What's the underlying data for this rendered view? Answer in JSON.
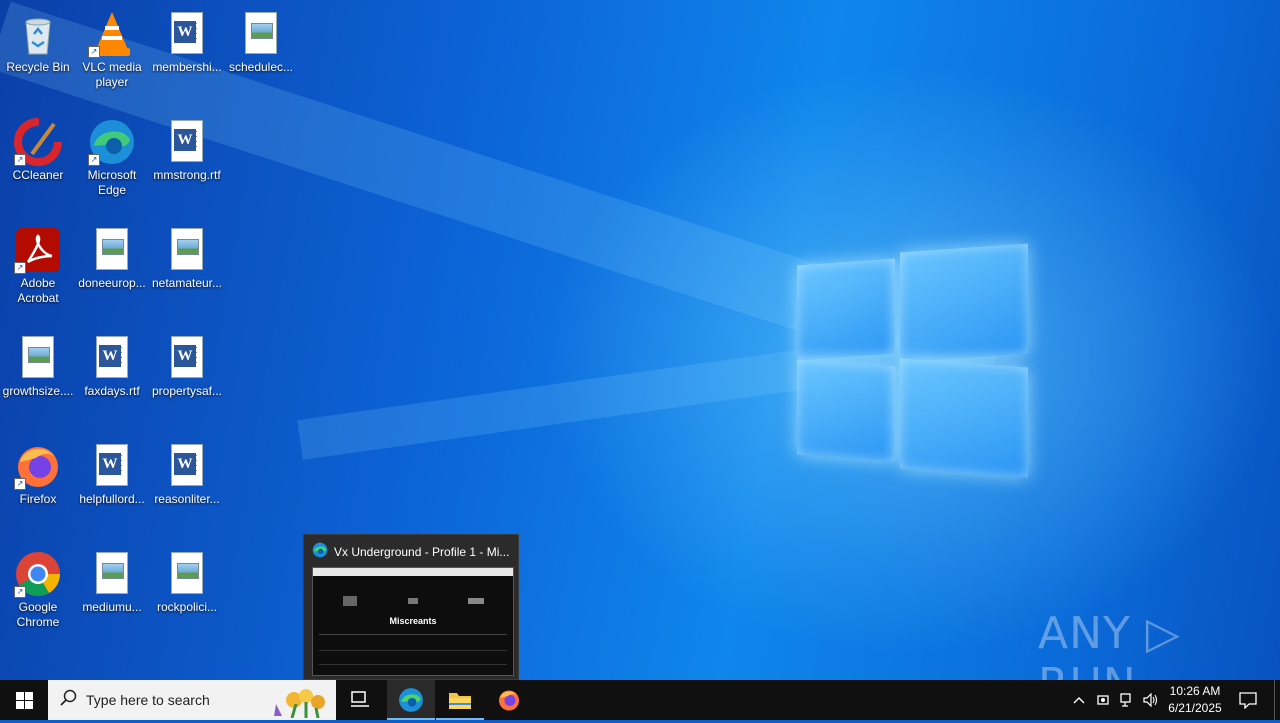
{
  "desktop": {
    "icons": [
      {
        "label": "Recycle Bin",
        "icon": "recycle-bin-icon"
      },
      {
        "label": "VLC media player",
        "icon": "vlc-icon"
      },
      {
        "label": "membershi...",
        "icon": "word-doc-icon"
      },
      {
        "label": "schedulec...",
        "icon": "image-doc-icon"
      },
      {
        "label": "CCleaner",
        "icon": "ccleaner-icon"
      },
      {
        "label": "Microsoft Edge",
        "icon": "edge-icon"
      },
      {
        "label": "mmstrong.rtf",
        "icon": "word-doc-icon"
      },
      {
        "label": "Adobe Acrobat",
        "icon": "acrobat-icon"
      },
      {
        "label": "doneeurop...",
        "icon": "image-doc-icon"
      },
      {
        "label": "netamateur...",
        "icon": "image-doc-icon"
      },
      {
        "label": "growthsize....",
        "icon": "image-doc-icon"
      },
      {
        "label": "faxdays.rtf",
        "icon": "word-doc-icon"
      },
      {
        "label": "propertysaf...",
        "icon": "word-doc-icon"
      },
      {
        "label": "Firefox",
        "icon": "firefox-icon"
      },
      {
        "label": "helpfullord...",
        "icon": "word-doc-icon"
      },
      {
        "label": "reasonliter...",
        "icon": "word-doc-icon"
      },
      {
        "label": "Google Chrome",
        "icon": "chrome-icon"
      },
      {
        "label": "mediumu...",
        "icon": "image-doc-icon"
      },
      {
        "label": "rockpolici...",
        "icon": "image-doc-icon"
      }
    ]
  },
  "preview": {
    "title": "Vx Underground - Profile 1 - Mi...",
    "thumb_heading": "Miscreants"
  },
  "watermark": {
    "text": "ANY ▷ RUN"
  },
  "taskbar": {
    "search_placeholder": "Type here to search",
    "time": "10:26 AM",
    "date": "6/21/2025",
    "accent": "#76b9ed"
  }
}
